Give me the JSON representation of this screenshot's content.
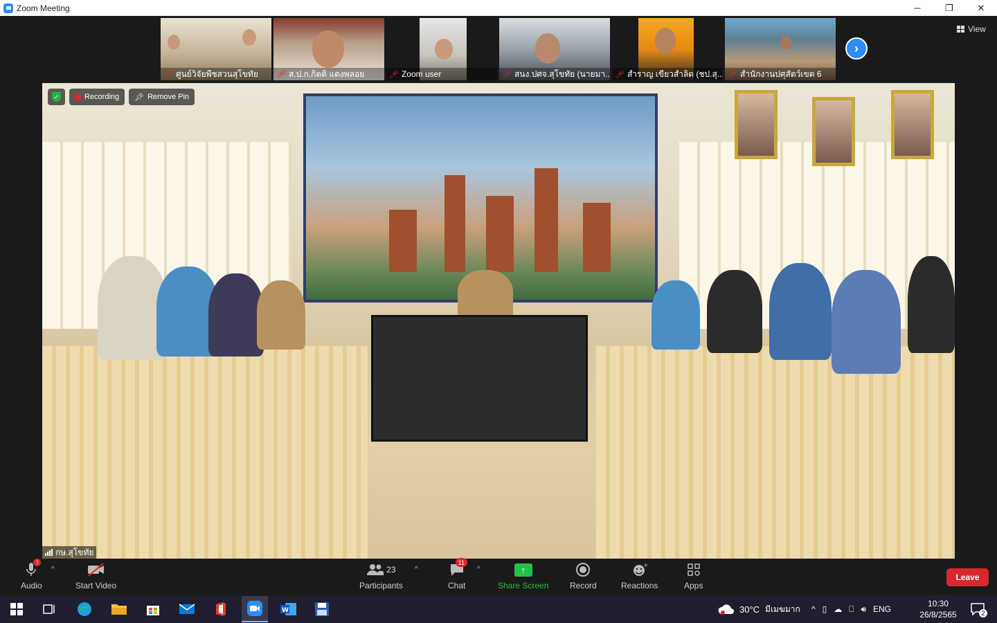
{
  "window": {
    "title": "Zoom Meeting",
    "minimize": "─",
    "maximize": "❐",
    "close": "✕"
  },
  "thumbnails": [
    {
      "name": "ศูนย์วิจัยพืชสวนสุโขทัย"
    },
    {
      "name": "ส.ป.ก.กิตติ แดงพลอย"
    },
    {
      "name": "Zoom user"
    },
    {
      "name": "สนง.ปศจ.สุโขทัย (นายมา..."
    },
    {
      "name": "สำราญ เขียวสำลิด (ชป.สุ..."
    },
    {
      "name": "สำนักงานปศุสัตว์เขต 6"
    }
  ],
  "view_label": "View",
  "main_video": {
    "recording_label": "Recording",
    "remove_pin_label": "Remove Pin",
    "participant_name": "กษ.สุโขทัย"
  },
  "toolbar": {
    "audio": "Audio",
    "start_video": "Start Video",
    "participants": "Participants",
    "participants_count": "23",
    "chat": "Chat",
    "chat_count": "11",
    "share_screen": "Share Screen",
    "record": "Record",
    "reactions": "Reactions",
    "apps": "Apps",
    "leave": "Leave"
  },
  "taskbar": {
    "weather": "30°C",
    "weather_desc": "มีเมฆมาก",
    "language": "ENG",
    "time": "10:30",
    "date": "26/8/2565",
    "notification_count": "2"
  },
  "colors": {
    "zoom_blue": "#2d8cff",
    "leave_red": "#d8282d",
    "share_green": "#24c24a",
    "muted_red": "#e02828"
  }
}
